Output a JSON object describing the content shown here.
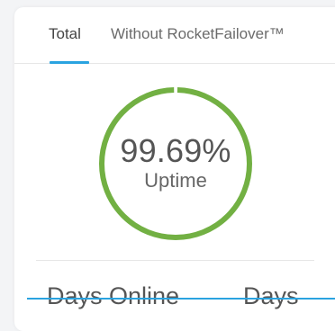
{
  "tabs": [
    {
      "label": "Total",
      "active": true
    },
    {
      "label": "Without RocketFailover™",
      "active": false
    }
  ],
  "uptime": {
    "value": "99.69%",
    "label": "Uptime",
    "progress": 0.9969,
    "color": "#72b043",
    "accent": "#2aa3e0"
  },
  "stats": [
    {
      "label": "Days Online"
    },
    {
      "label": "Days"
    }
  ]
}
